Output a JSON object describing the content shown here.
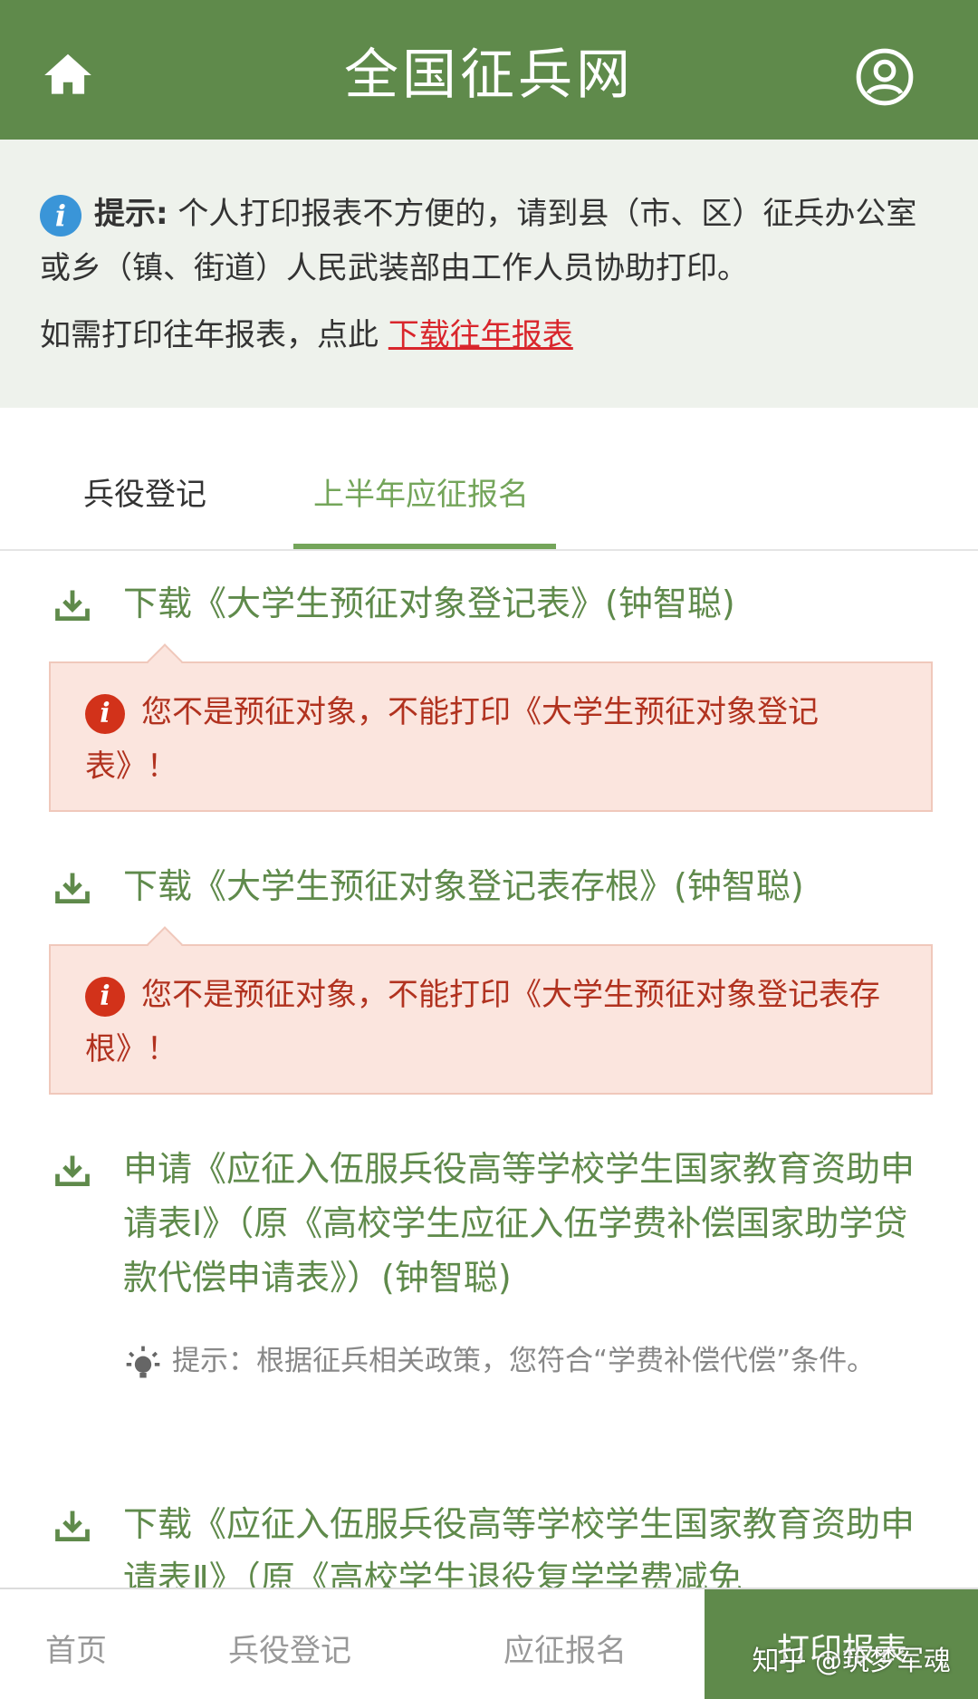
{
  "header": {
    "title": "全国征兵网"
  },
  "notice": {
    "tip_label": "提示:",
    "tip_text": " 个人打印报表不方便的，请到县（市、区）征兵办公室或乡（镇、街道）人民武装部由工作人员协助打印。",
    "line2_text": "如需打印往年报表，点此 ",
    "line2_link": "下载往年报表"
  },
  "tabs": [
    {
      "label": "兵役登记"
    },
    {
      "label": "上半年应征报名"
    }
  ],
  "items": [
    {
      "text": "下载《大学生预征对象登记表》(钟智聪)",
      "alert": "您不是预征对象，不能打印《大学生预征对象登记表》！"
    },
    {
      "text": "下载《大学生预征对象登记表存根》(钟智聪)",
      "alert": "您不是预征对象，不能打印《大学生预征对象登记表存根》！"
    },
    {
      "text": "申请《应征入伍服兵役高等学校学生国家教育资助申请表Ⅰ》（原《高校学生应征入伍学费补偿国家助学贷款代偿申请表》）(钟智聪)",
      "hint": "提示：根据征兵相关政策，您符合“学费补偿代偿”条件。"
    },
    {
      "text": "下载《应征入伍服兵役高等学校学生国家教育资助申请表Ⅱ》（原《高校学生退役复学学费减免"
    }
  ],
  "bottom_nav": [
    {
      "label": "首页"
    },
    {
      "label": "兵役登记"
    },
    {
      "label": "应征报名"
    },
    {
      "label": "打印报表"
    }
  ],
  "watermark": "知乎 @筑梦军魂",
  "colors": {
    "header_bg": "#5f8a4b",
    "accent": "#74a55a",
    "alert_bg": "#fbe5de",
    "alert_text": "#b1321f",
    "link": "#d9262c"
  }
}
